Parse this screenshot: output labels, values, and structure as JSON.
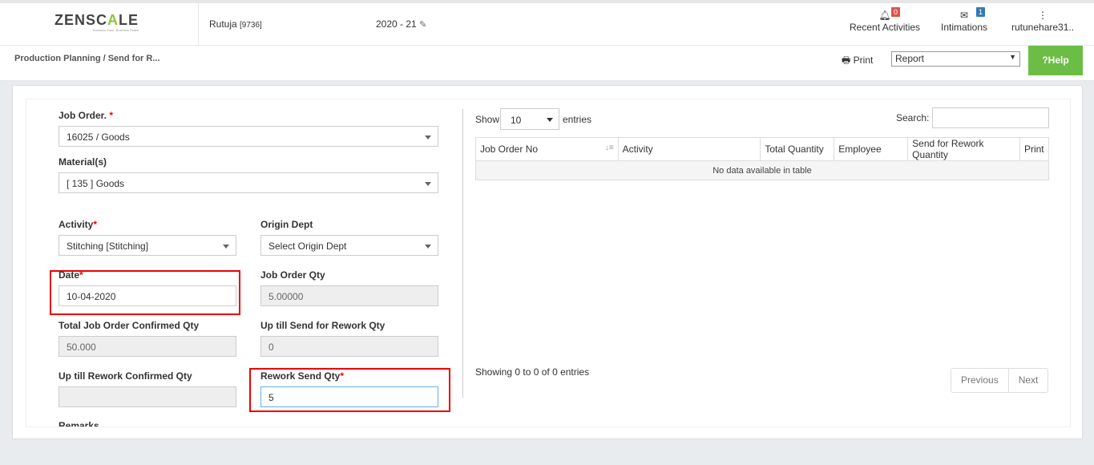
{
  "header": {
    "logo_main": "ZENSC",
    "logo_accent": "A",
    "logo_end": "LE",
    "logo_tagline": "Business Ease. Business Peace.",
    "user_name": "Rutuja",
    "user_id": "[9736]",
    "fiscal_year": "2020 - 21",
    "recent_activities_label": "Recent Activities",
    "recent_activities_count": "0",
    "intimations_label": "Intimations",
    "intimations_count": "1",
    "account_label": "rutunehare31.."
  },
  "subbar": {
    "breadcrumb": "Production Planning  / Send for R...",
    "print_label": "Print",
    "report_value": "Report",
    "help_label": "Help"
  },
  "form": {
    "job_order_label": "Job Order.",
    "job_order_value": "16025 / Goods",
    "material_label": "Material(s)",
    "material_value": "[ 135 ] Goods",
    "activity_label": "Activity",
    "activity_value": "Stitching [Stitching]",
    "origin_dept_label": "Origin Dept",
    "origin_dept_value": "Select Origin Dept",
    "date_label": "Date",
    "date_value": "10-04-2020",
    "job_order_qty_label": "Job Order Qty",
    "job_order_qty_value": "5.00000",
    "total_confirmed_label": "Total Job Order Confirmed Qty",
    "total_confirmed_value": "50.000",
    "uptill_send_label": "Up till Send for Rework Qty",
    "uptill_send_value": "0",
    "uptill_confirmed_label": "Up till Rework Confirmed Qty",
    "uptill_confirmed_value": "",
    "rework_send_label": "Rework Send Qty",
    "rework_send_value": "5",
    "remarks_label": "Remarks",
    "required_mark": "*"
  },
  "table": {
    "show_label": "Show",
    "entries_count": "10",
    "entries_label": "entries",
    "search_label": "Search:",
    "columns": [
      "Job Order No",
      "Activity",
      "Total Quantity",
      "Employee",
      "Send for Rework Quantity",
      "Print"
    ],
    "empty_message": "No data available in table",
    "info": "Showing 0 to 0 of 0 entries",
    "previous_label": "Previous",
    "next_label": "Next"
  }
}
